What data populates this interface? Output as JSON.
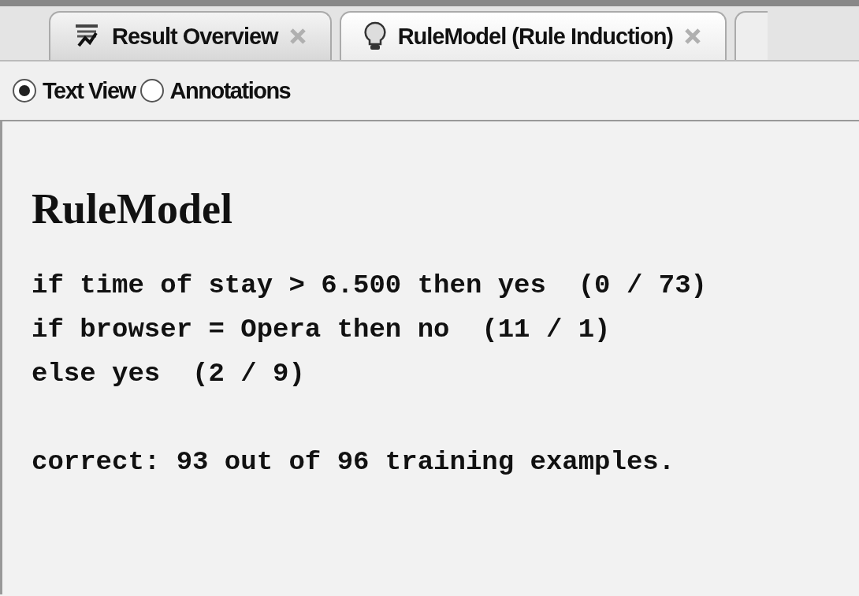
{
  "tabs": [
    {
      "label": "Result Overview",
      "selected": false
    },
    {
      "label": "RuleModel (Rule Induction)",
      "selected": true
    }
  ],
  "view_options": [
    {
      "label": "Text View",
      "selected": true
    },
    {
      "label": "Annotations",
      "selected": false
    }
  ],
  "model": {
    "title": "RuleModel",
    "rules": [
      "if time of stay > 6.500 then yes  (0 / 73)",
      "if browser = Opera then no  (11 / 1)",
      "else yes  (2 / 9)"
    ],
    "summary": "correct: 93 out of 96 training examples."
  }
}
